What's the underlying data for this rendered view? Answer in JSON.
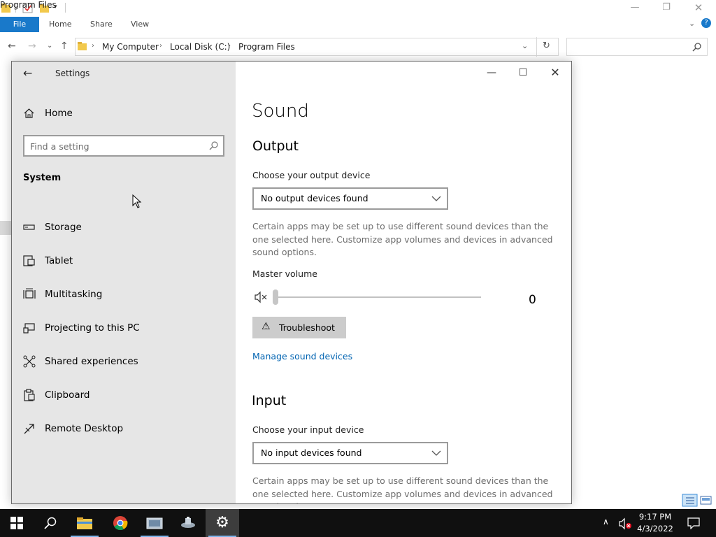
{
  "explorer": {
    "title": "Program Files",
    "ribbon_tabs": {
      "file": "File",
      "home": "Home",
      "share": "Share",
      "view": "View"
    },
    "breadcrumb": [
      "My Computer",
      "Local Disk (C:)",
      "Program Files"
    ]
  },
  "settings": {
    "app_title": "Settings",
    "home_label": "Home",
    "search_placeholder": "Find a setting",
    "section_label": "System",
    "nav_items": [
      {
        "label": "Storage",
        "icon": "storage-icon"
      },
      {
        "label": "Tablet",
        "icon": "tablet-icon"
      },
      {
        "label": "Multitasking",
        "icon": "multitasking-icon"
      },
      {
        "label": "Projecting to this PC",
        "icon": "projecting-icon"
      },
      {
        "label": "Shared experiences",
        "icon": "shared-experiences-icon"
      },
      {
        "label": "Clipboard",
        "icon": "clipboard-icon"
      },
      {
        "label": "Remote Desktop",
        "icon": "remote-desktop-icon"
      }
    ],
    "page_title": "Sound",
    "output": {
      "heading": "Output",
      "device_label": "Choose your output device",
      "device_value": "No output devices found",
      "description": "Certain apps may be set up to use different sound devices than the one selected here. Customize app volumes and devices in advanced sound options."
    },
    "master_volume": {
      "label": "Master volume",
      "value": "0"
    },
    "troubleshoot_label": "Troubleshoot",
    "manage_link": "Manage sound devices",
    "input": {
      "heading": "Input",
      "device_label": "Choose your input device",
      "device_value": "No input devices found",
      "description": "Certain apps may be set up to use different sound devices than the one selected here. Customize app volumes and devices in advanced sound options."
    }
  },
  "taskbar": {
    "time": "9:17 PM",
    "date": "4/3/2022"
  },
  "colors": {
    "accent": "#0063b1",
    "file_tab": "#1979ca",
    "sidebar_bg": "#e6e6e6",
    "taskbar_bg": "#101010"
  }
}
